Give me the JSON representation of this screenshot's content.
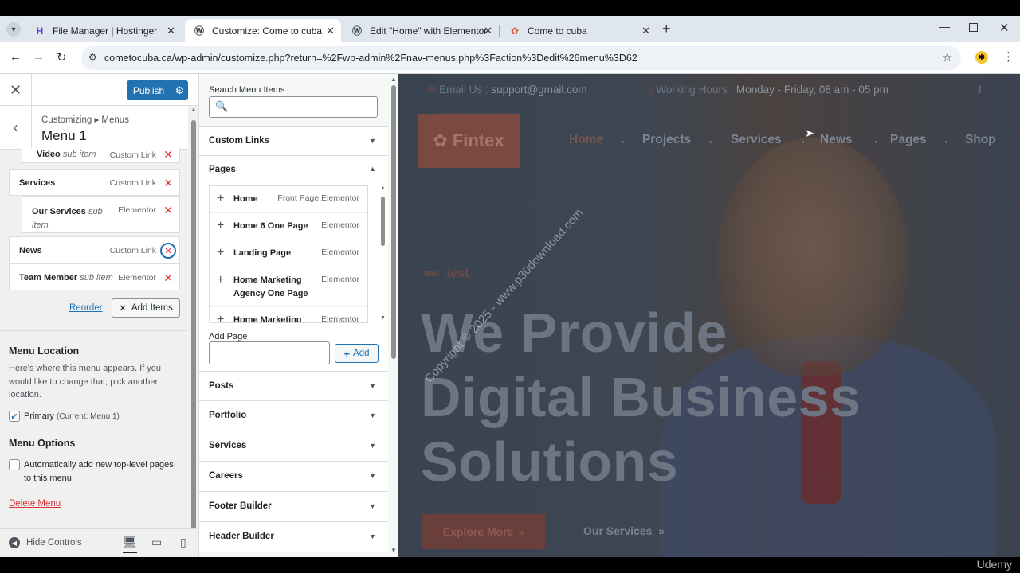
{
  "browser": {
    "tabs": [
      {
        "label": "File Manager | Hostinger",
        "icon": "hostinger-icon"
      },
      {
        "label": "Customize: Come to cuba",
        "icon": "wordpress-icon"
      },
      {
        "label": "Edit \"Home\" with Elementor",
        "icon": "wordpress-icon"
      },
      {
        "label": "Come to cuba",
        "icon": "site-favicon"
      }
    ],
    "url": "cometocuba.ca/wp-admin/customize.php?return=%2Fwp-admin%2Fnav-menus.php%3Faction%3Dedit%26menu%3D62"
  },
  "customizer": {
    "publish_label": "Publish",
    "breadcrumb": "Customizing ▸ Menus",
    "menu_title": "Menu 1",
    "menu_items": [
      {
        "name": "Video",
        "sub": "sub item",
        "type": "Custom Link"
      },
      {
        "name": "Services",
        "sub": "",
        "type": "Custom Link"
      },
      {
        "name": "Our Services",
        "sub": "sub item",
        "type": "Elementor"
      },
      {
        "name": "News",
        "sub": "",
        "type": "Custom Link"
      },
      {
        "name": "Team Member",
        "sub": "sub item",
        "type": "Elementor"
      }
    ],
    "reorder_label": "Reorder",
    "add_items_label": "Add Items",
    "menu_location_heading": "Menu Location",
    "menu_location_desc": "Here's where this menu appears. If you would like to change that, pick another location.",
    "primary_label": "Primary",
    "primary_current": "(Current: Menu 1)",
    "menu_options_heading": "Menu Options",
    "auto_add_label": "Automatically add new top-level pages to this menu",
    "delete_menu_label": "Delete Menu",
    "hide_controls_label": "Hide Controls"
  },
  "available": {
    "search_label": "Search Menu Items",
    "sections_top": [
      "Custom Links",
      "Pages"
    ],
    "pages": [
      {
        "name": "Home",
        "type": "Front Page,Elementor"
      },
      {
        "name": "Home 6 One Page",
        "type": "Elementor"
      },
      {
        "name": "Landing Page",
        "type": "Elementor"
      },
      {
        "name": "Home Marketing Agency One Page",
        "type": "Elementor"
      },
      {
        "name": "Home Marketing",
        "type": "Elementor"
      }
    ],
    "add_page_label": "Add Page",
    "add_button_label": "Add",
    "sections_bottom": [
      "Posts",
      "Portfolio",
      "Services",
      "Careers",
      "Footer Builder",
      "Header Builder"
    ]
  },
  "preview": {
    "email_label": "Email Us :",
    "email": "support@gmail.com",
    "hours_label": "Working Hours :",
    "hours": "Monday - Friday, 08 am - 05 pm",
    "logo_text": "Fintex",
    "nav": [
      "Home",
      "Projects",
      "Services",
      "News",
      "Pages",
      "Shop"
    ],
    "tagline": "test",
    "hero_lines": [
      "We Provide",
      "Digital Business",
      "Solutions"
    ],
    "explore_label": "Explore More",
    "our_services_label": "Our Services",
    "watermark": "Copyright © 2025 - www.p30download.com",
    "udemy": "Udemy"
  }
}
